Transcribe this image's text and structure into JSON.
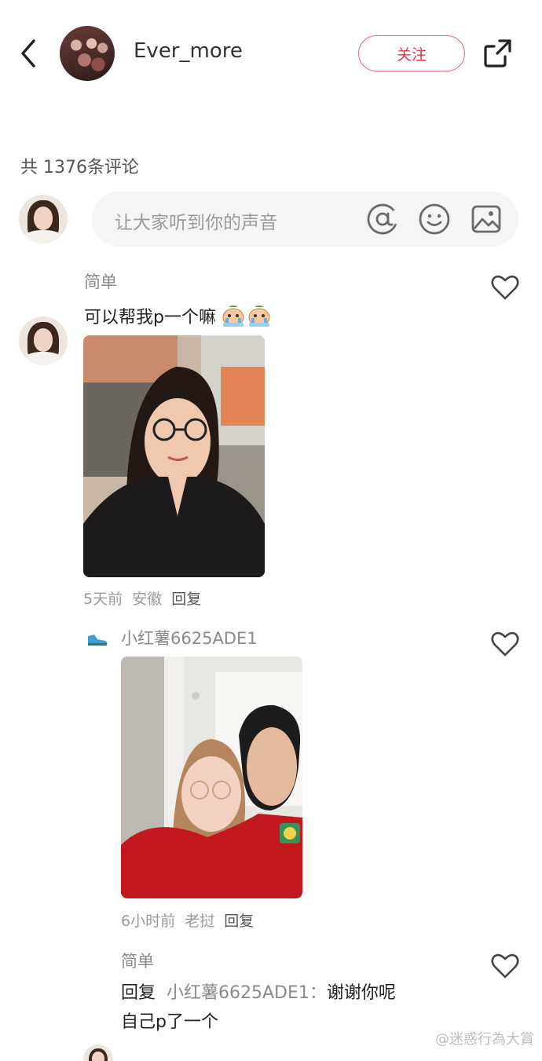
{
  "header": {
    "back_icon": "chevron-left-icon",
    "username": "Ever_more",
    "follow_label": "关注",
    "share_icon": "share-external-icon",
    "accent_color": "#e0364a"
  },
  "comments_header": {
    "count_text": "共 1376条评论"
  },
  "composer": {
    "placeholder": "让大家听到你的声音",
    "icons": [
      "at-icon",
      "emoji-icon",
      "image-icon"
    ]
  },
  "comments": [
    {
      "author": "简单",
      "text": "可以帮我p一个嘛",
      "emoji": "crying-icon",
      "time": "5天前",
      "location": "安徽",
      "reply_label": "回复"
    },
    {
      "author": "小红薯6625ADE1",
      "badge": "shoe-icon",
      "time": "6小时前",
      "location": "老挝",
      "reply_label": "回复"
    },
    {
      "author": "简单",
      "reply_prefix": "回复",
      "reply_to": "小红薯6625ADE1：",
      "text_line1": "谢谢你呢",
      "text_line2": "自己p了一个"
    }
  ],
  "watermark": "@迷惑行為大賞"
}
